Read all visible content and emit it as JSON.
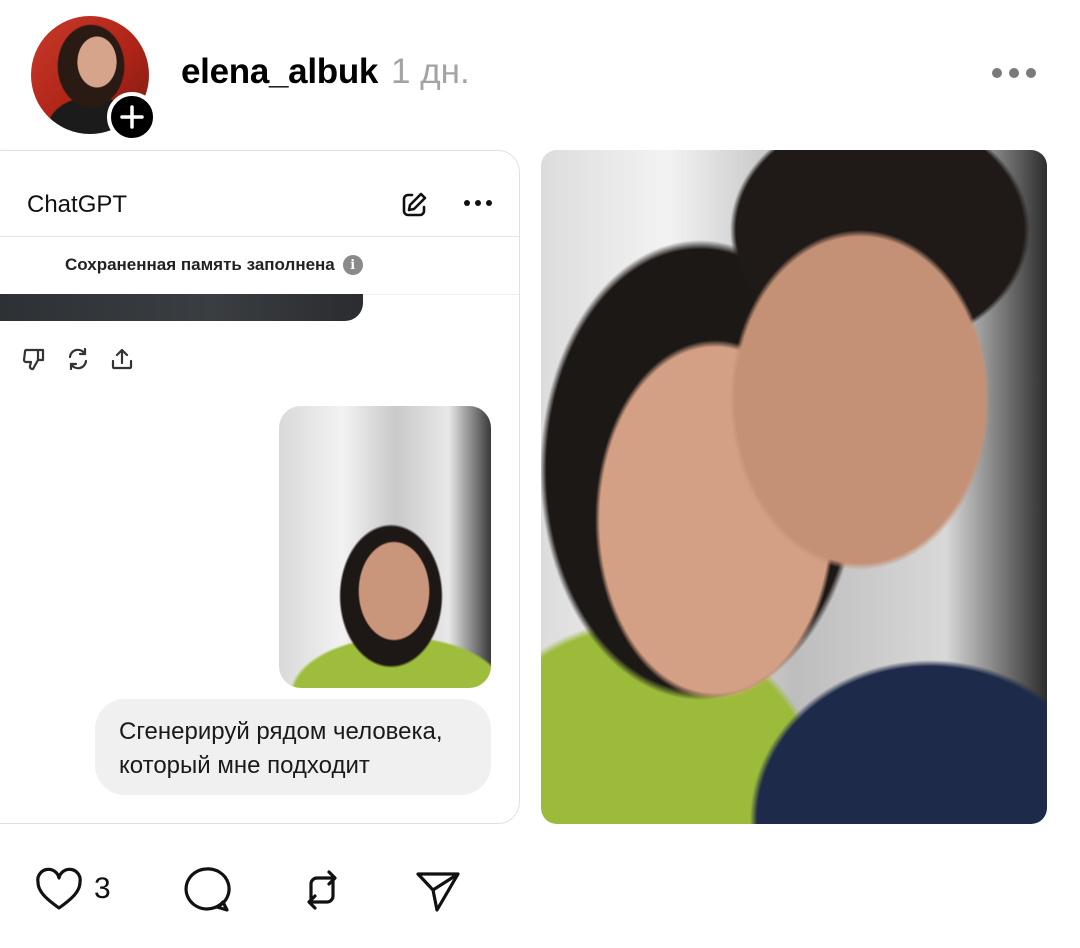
{
  "post": {
    "username": "elena_albuk",
    "timestamp": "1 дн.",
    "like_count": "3"
  },
  "chat_card": {
    "app_title": "ChatGPT",
    "memory_notice": "Сохраненная память заполнена",
    "user_message": "Сгенерируй рядом человека, который мне подходит"
  },
  "icons": {
    "avatar": "avatar-photo",
    "follow": "plus-icon",
    "more": "more-horizontal-icon",
    "edit": "edit-icon",
    "info": "info-icon",
    "dislike": "thumbs-down-icon",
    "regenerate": "regenerate-icon",
    "share": "share-icon",
    "like": "heart-icon",
    "comment": "comment-icon",
    "repost": "repost-icon",
    "send": "send-icon"
  },
  "colors": {
    "text_primary": "#000000",
    "text_muted": "#a3a3a3",
    "bubble_bg": "#f0f0f0"
  }
}
